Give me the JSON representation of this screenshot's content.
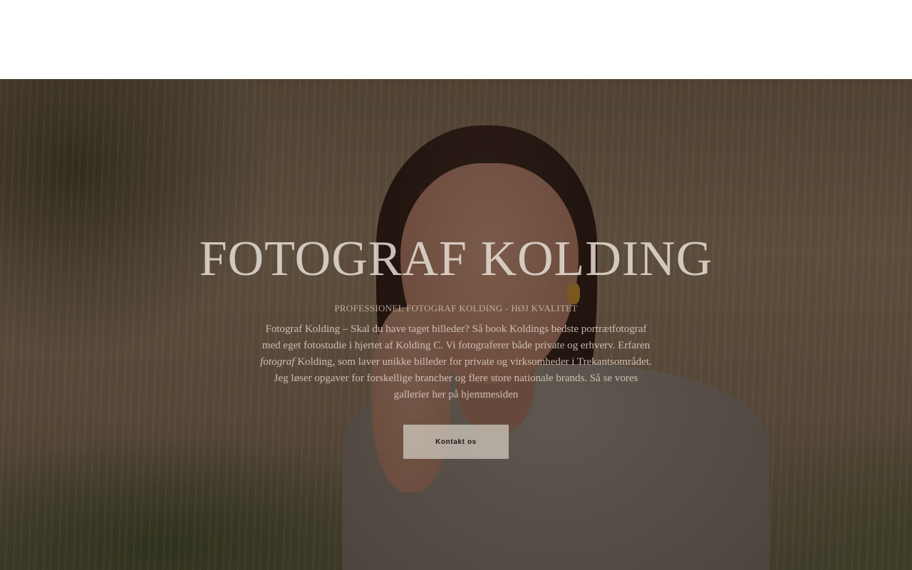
{
  "hero": {
    "title": "FOTOGRAF KOLDING",
    "subtitle": "PROFESSIONEL FOTOGRAF KOLDING - HØJ KVALITET",
    "description": {
      "part1": "Fotograf Kolding – Skal du have taget billeder? Så book Koldings bedste portrætfotograf med eget fotostudie i hjertet af Kolding C. Vi fotograferer både private og erhverv. Erfaren ",
      "italic": "fotograf",
      "part2": " Kolding, som laver unikke billeder for private og virksomheder i Trekantsområdet. Jeg løser opgaver for forskellige brancher og flere store nationale brands. Så se vores gallerier her på hjemmesiden"
    },
    "cta_label": "Kontakt os"
  }
}
